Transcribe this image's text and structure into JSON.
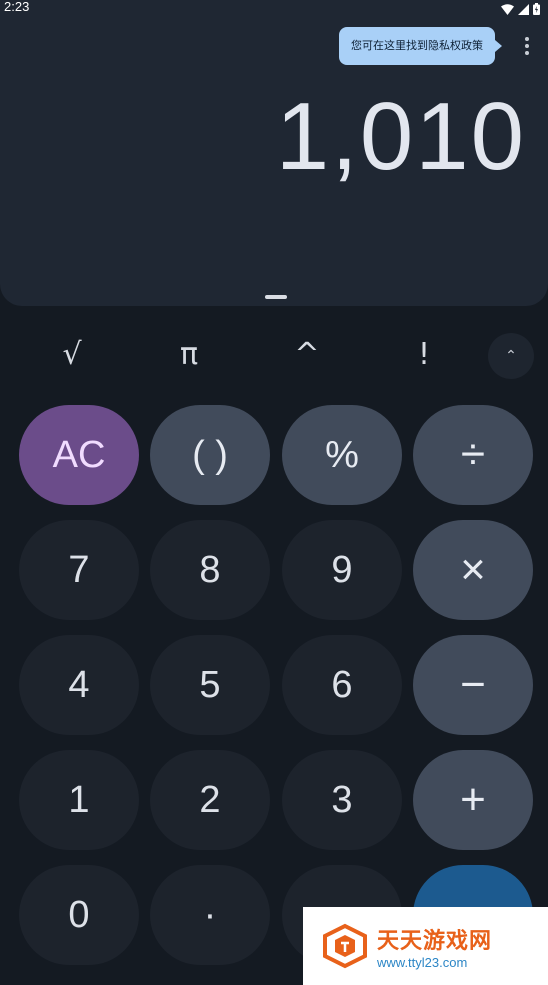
{
  "status_bar": {
    "time": "2:23",
    "icons": [
      "wifi-icon",
      "cell-signal-icon",
      "battery-icon"
    ]
  },
  "display": {
    "tooltip": "您可在这里找到隐私权政策",
    "result": "1,010",
    "overflow_icon": "more-vert-icon"
  },
  "scientific": {
    "sqrt": "√",
    "pi": "π",
    "power": "^",
    "factorial": "!",
    "expand_icon": "chevron-up-icon",
    "expand_glyph": "⌃"
  },
  "keypad": {
    "ac": "AC",
    "paren": "( )",
    "percent": "%",
    "divide": "÷",
    "seven": "7",
    "eight": "8",
    "nine": "9",
    "multiply": "×",
    "four": "4",
    "five": "5",
    "six": "6",
    "minus": "−",
    "one": "1",
    "two": "2",
    "three": "3",
    "plus": "+",
    "zero": "0",
    "decimal": "·"
  },
  "watermark": {
    "title": "天天游戏网",
    "url": "www.ttyl23.com"
  },
  "colors": {
    "accent_ac": "#6b4c8a",
    "operator": "#414b5b",
    "equals": "#1c5a8f",
    "display_bg": "#1f2733",
    "tooltip_bg": "#a9d0f7"
  }
}
